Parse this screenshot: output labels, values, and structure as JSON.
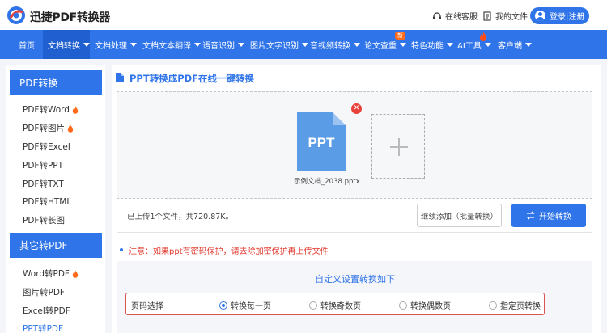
{
  "header": {
    "brand": "迅捷PDF转换器",
    "service_label": "在线客服",
    "files_label": "我的文件",
    "login_label": "登录|注册"
  },
  "nav": {
    "items": [
      {
        "label": "首页"
      },
      {
        "label": "文档转换"
      },
      {
        "label": "文档处理"
      },
      {
        "label": "文档文本翻译"
      },
      {
        "label": "语音识别"
      },
      {
        "label": "图片文字识别"
      },
      {
        "label": "音视频转换"
      },
      {
        "label": "论文查重"
      },
      {
        "label": "特色功能"
      },
      {
        "label": "AI工具"
      },
      {
        "label": "客户端"
      }
    ],
    "new_badge": "新"
  },
  "sidebar": {
    "section1_title": "PDF转换",
    "section1_items": [
      {
        "label": "PDF转Word"
      },
      {
        "label": "PDF转图片"
      },
      {
        "label": "PDF转Excel"
      },
      {
        "label": "PDF转PPT"
      },
      {
        "label": "PDF转TXT"
      },
      {
        "label": "PDF转HTML"
      },
      {
        "label": "PDF转长图"
      }
    ],
    "section2_title": "其它转PDF",
    "section2_items": [
      {
        "label": "Word转PDF"
      },
      {
        "label": "图片转PDF"
      },
      {
        "label": "Excel转PDF"
      },
      {
        "label": "PPT转PDF"
      }
    ]
  },
  "main": {
    "title": "PPT转换成PDF在线一键转换",
    "file_icon_text": "PPT",
    "file_name": "示例文档_2038.pptx",
    "upload_info": "已上传1个文件，共720.87K。",
    "continue_button": "继续添加（批量转换）",
    "start_button": "开始转换",
    "note": "注意：如果ppt有密码保护，请去除加密保护再上传文件",
    "settings_title": "自定义设置转换如下",
    "page_select_label": "页码选择",
    "options": [
      {
        "label": "转换每一页",
        "selected": true
      },
      {
        "label": "转换奇数页",
        "selected": false
      },
      {
        "label": "转换偶数页",
        "selected": false
      },
      {
        "label": "指定页转换",
        "selected": false
      }
    ]
  },
  "colors": {
    "brand_blue": "#2f74e8",
    "warning_red": "#e23a2e",
    "new_badge": "#ff6a1a",
    "file_icon": "#5b9ce6"
  }
}
